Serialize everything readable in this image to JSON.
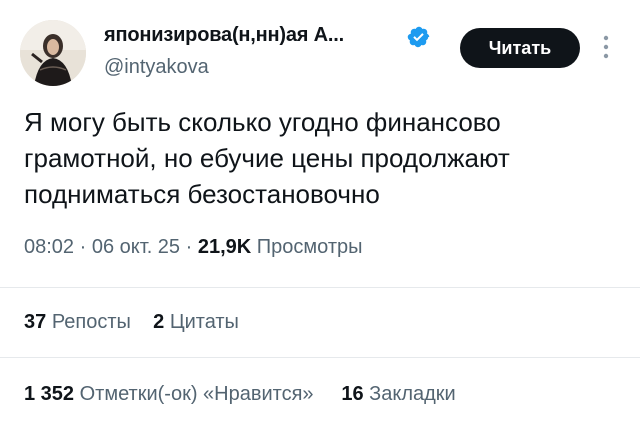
{
  "author": {
    "display_name": "японизирова(н,нн)ая А...",
    "handle": "@intyakova",
    "verified": true
  },
  "follow_button_label": "Читать",
  "tweet": {
    "text": "Я могу быть сколько угодно финансово\nграмотной, но ебучие цены продолжают\nподниматься безостановочно"
  },
  "meta": {
    "time": "08:02",
    "separator": " · ",
    "date": "06 окт. 25",
    "views_count": "21,9K",
    "views_label": "Просмотры"
  },
  "stats": {
    "reposts_count": "37",
    "reposts_label": "Репосты",
    "quotes_count": "2",
    "quotes_label": "Цитаты",
    "likes_count": "1 352",
    "likes_label": "Отметки(-ок) «Нравится»",
    "bookmarks_count": "16",
    "bookmarks_label": "Закладки"
  },
  "colors": {
    "text_primary": "#0f1419",
    "text_secondary": "#536471",
    "verified_badge": "#1d9bf0",
    "follow_button_bg": "#0f1419",
    "divider": "#e6e9ec"
  }
}
